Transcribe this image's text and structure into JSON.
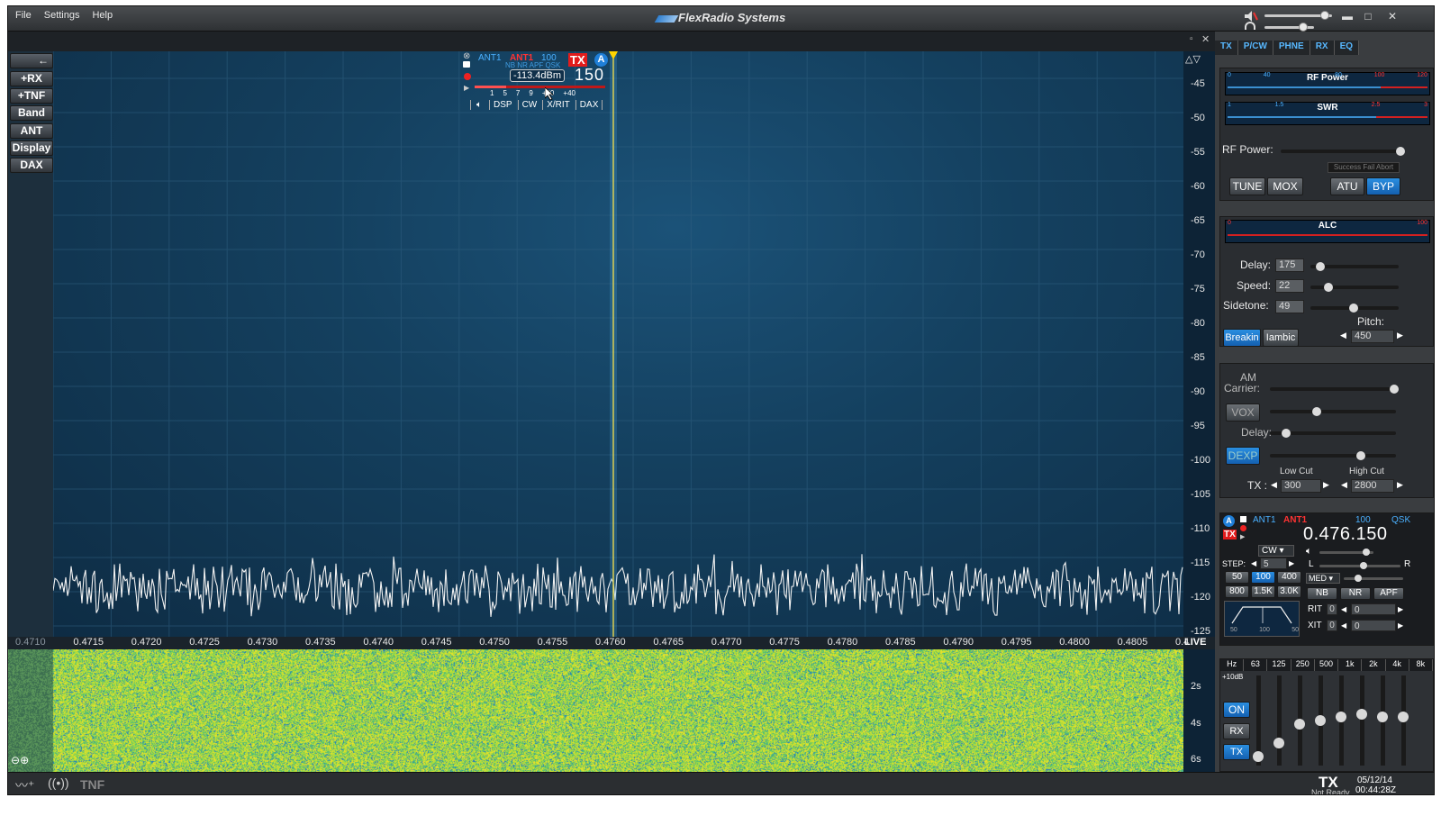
{
  "app": {
    "title": "FlexRadio Systems",
    "menu": [
      "File",
      "Settings",
      "Help"
    ]
  },
  "left_strip": {
    "back_label": "←",
    "buttons": [
      "+RX",
      "+TNF",
      "Band",
      "ANT",
      "Display",
      "DAX"
    ]
  },
  "slice": {
    "rx_ant": "ANT1",
    "tx_ant": "ANT1",
    "power": "100",
    "tx_badge": "TX",
    "slice_letter": "A",
    "flags": "NB NR APF QSK",
    "dbm": "-113.4dBm",
    "freq_suffix": "150",
    "s_scale": [
      "1",
      "5",
      "7",
      "9",
      "+20",
      "+40"
    ],
    "tabs": [
      "DSP",
      "CW",
      "X/RIT",
      "DAX"
    ]
  },
  "y_axis": [
    "-45",
    "-50",
    "-55",
    "-60",
    "-65",
    "-70",
    "-75",
    "-80",
    "-85",
    "-90",
    "-95",
    "-100",
    "-105",
    "-110",
    "-115",
    "-120",
    "-125"
  ],
  "x_axis": [
    "0.4710",
    "0.4715",
    "0.4720",
    "0.4725",
    "0.4730",
    "0.4735",
    "0.4740",
    "0.4745",
    "0.4750",
    "0.4755",
    "0.4760",
    "0.4765",
    "0.4770",
    "0.4775",
    "0.4780",
    "0.4785",
    "0.4790",
    "0.4795",
    "0.4800",
    "0.4805",
    "0.4"
  ],
  "x_axis_live": "LIVE",
  "waterfall_axis": [
    "2s",
    "4s",
    "6s"
  ],
  "status_bar": {
    "tnf_label": "TNF",
    "tx_state": "TX",
    "tx_sub": "Not Ready",
    "date": "05/12/14",
    "time": "00:44:28Z"
  },
  "right_panel": {
    "tabs": [
      "TX",
      "P/CW",
      "PHNE",
      "RX",
      "EQ"
    ],
    "rf_power_meter": {
      "label": "RF Power",
      "ticks": [
        "0",
        "40",
        "80",
        "100",
        "120"
      ]
    },
    "swr_meter": {
      "label": "SWR",
      "ticks": [
        "1",
        "1.5",
        "2.5",
        "3"
      ]
    },
    "rf_power_label": "RF Power:",
    "rf_power_level": 0.98,
    "atu_status": "Success Fail Abort",
    "tune": "TUNE",
    "mox": "MOX",
    "atu": "ATU",
    "byp": "BYP",
    "alc_meter": {
      "label": "ALC",
      "ticks": [
        "0",
        "100"
      ]
    },
    "cw": {
      "delay_label": "Delay:",
      "delay": "175",
      "speed_label": "Speed:",
      "speed": "22",
      "sidetone_label": "Sidetone:",
      "sidetone": "49",
      "breakin": "Breakin",
      "iambic": "Iambic",
      "pitch_label": "Pitch:",
      "pitch": "450"
    },
    "phone": {
      "am_label": "AM",
      "carrier_label": "Carrier:",
      "vox": "VOX",
      "delay_label": "Delay:",
      "dexp": "DEXP",
      "low_cut_label": "Low Cut",
      "high_cut_label": "High Cut",
      "tx_label": "TX :",
      "low_cut": "300",
      "high_cut": "2800"
    },
    "rx": {
      "rx_ant": "ANT1",
      "tx_ant": "ANT1",
      "power": "100",
      "qsk": "QSK",
      "freq": "0.476.150",
      "mode": "CW",
      "step_label": "STEP:",
      "step": "5",
      "filters": [
        "50",
        "100",
        "400",
        "800",
        "1.5K",
        "3.0K"
      ],
      "filter_selected": "100",
      "agc": "MED",
      "nb": "NB",
      "nr": "NR",
      "apf": "APF",
      "rit_label": "RIT",
      "rit_on": "0",
      "rit_val": "0",
      "xit_label": "XIT",
      "xit_on": "0",
      "xit_val": "0",
      "lr_left": "L",
      "lr_right": "R",
      "bw_labels": [
        "50",
        "100",
        "50"
      ]
    },
    "eq": {
      "bands": [
        "Hz",
        "63",
        "125",
        "250",
        "500",
        "1k",
        "2k",
        "4k",
        "8k"
      ],
      "gain_label": "+10dB",
      "on": "ON",
      "rx": "RX",
      "tx": "TX",
      "levels": [
        0.05,
        0.22,
        0.45,
        0.5,
        0.55,
        0.58,
        0.55,
        0.55
      ]
    }
  },
  "colors": {
    "accent_blue": "#1f7fd8",
    "tx_red": "#e02020",
    "panadapter_bg": "#14405f",
    "spectrum_trace": "#ffffff",
    "marker_yellow": "#ffd400"
  }
}
